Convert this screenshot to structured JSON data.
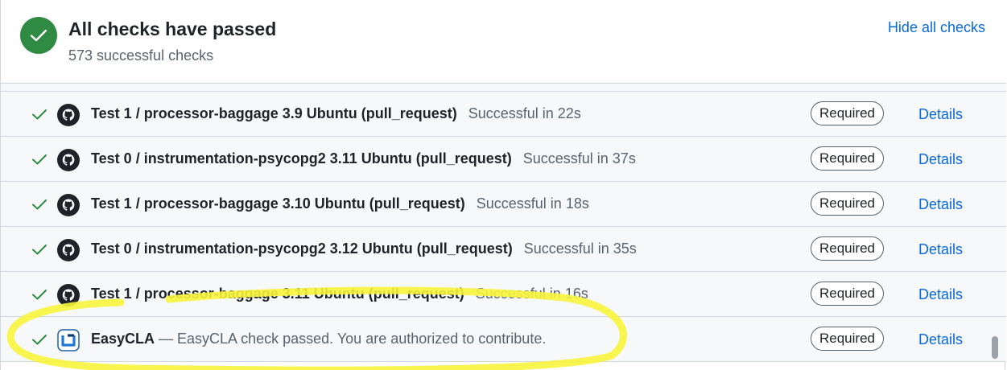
{
  "summary": {
    "title": "All checks have passed",
    "subtitle": "573 successful checks",
    "hide_link": "Hide all checks",
    "status_icon": "check-circle-icon",
    "status_color": "#2f8a44"
  },
  "checks": [
    {
      "name": "Test 1 / processor-baggage 3.9 Ubuntu (pull_request)",
      "desc": "Successful in 22s",
      "badge": "Required",
      "action": "Details",
      "logo": "github-icon"
    },
    {
      "name": "Test 0 / instrumentation-psycopg2 3.11 Ubuntu (pull_request)",
      "desc": "Successful in 37s",
      "badge": "Required",
      "action": "Details",
      "logo": "github-icon"
    },
    {
      "name": "Test 1 / processor-baggage 3.10 Ubuntu (pull_request)",
      "desc": "Successful in 18s",
      "badge": "Required",
      "action": "Details",
      "logo": "github-icon"
    },
    {
      "name": "Test 0 / instrumentation-psycopg2 3.12 Ubuntu (pull_request)",
      "desc": "Successful in 35s",
      "badge": "Required",
      "action": "Details",
      "logo": "github-icon"
    },
    {
      "name": "Test 1 / processor-baggage 3.11 Ubuntu (pull_request)",
      "desc": "Successful in 16s",
      "badge": "Required",
      "action": "Details",
      "logo": "github-icon"
    },
    {
      "name": "EasyCLA",
      "desc": " — EasyCLA check passed. You are authorized to contribute.",
      "badge": "Required",
      "action": "Details",
      "logo": "easycla-icon"
    }
  ],
  "colors": {
    "accent": "#0969da",
    "success": "#2f8a44",
    "highlight": "#f7f43b"
  }
}
